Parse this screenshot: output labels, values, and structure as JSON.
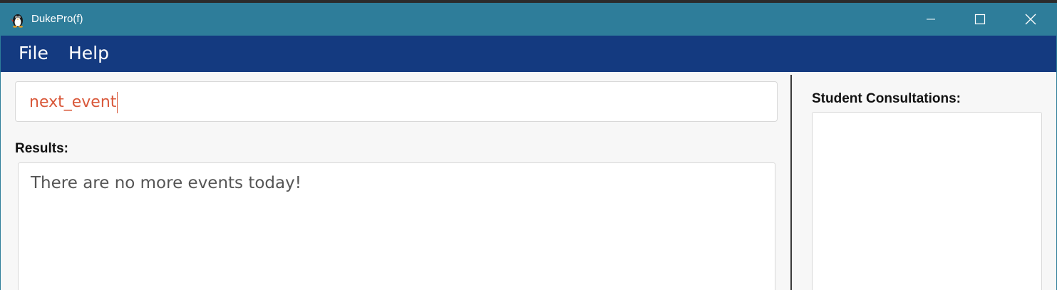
{
  "window": {
    "title": "DukePro(f)",
    "controls": {
      "minimize_icon": "minimize-icon",
      "maximize_icon": "maximize-icon",
      "close_icon": "close-icon"
    }
  },
  "menu": {
    "items": [
      {
        "label": "File"
      },
      {
        "label": "Help"
      }
    ]
  },
  "command": {
    "value": "next_event"
  },
  "results": {
    "label": "Results:",
    "text": "There are no more events today!"
  },
  "sidebar": {
    "label": "Student Consultations:",
    "items": []
  },
  "colors": {
    "titlebar": "#2e7d9a",
    "menubar": "#143a80",
    "command_text": "#d9583a"
  }
}
